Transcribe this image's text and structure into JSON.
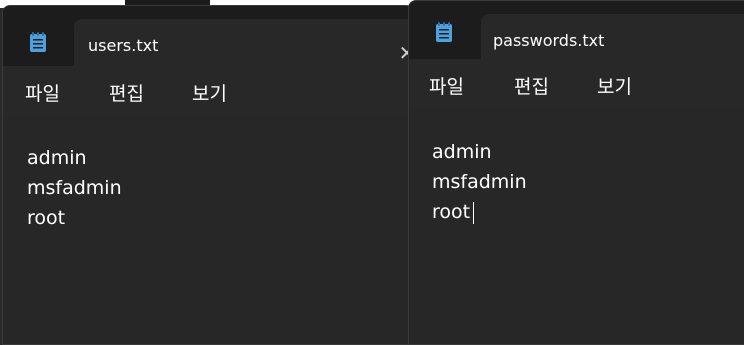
{
  "left_window": {
    "tab_title": "users.txt",
    "icon": "notepad-icon",
    "menu": [
      "파일",
      "편집",
      "보기"
    ],
    "lines": [
      "admin",
      "msfadmin",
      "root"
    ],
    "close_glyph": "✕"
  },
  "right_window": {
    "tab_title": "passwords.txt",
    "icon": "notepad-icon",
    "menu": [
      "파일",
      "편집",
      "보기"
    ],
    "lines": [
      "admin",
      "msfadmin",
      "root"
    ]
  },
  "colors": {
    "background": "#202020",
    "tab": "#282828",
    "icon_blue": "#4aa3df",
    "text": "#ffffff"
  }
}
